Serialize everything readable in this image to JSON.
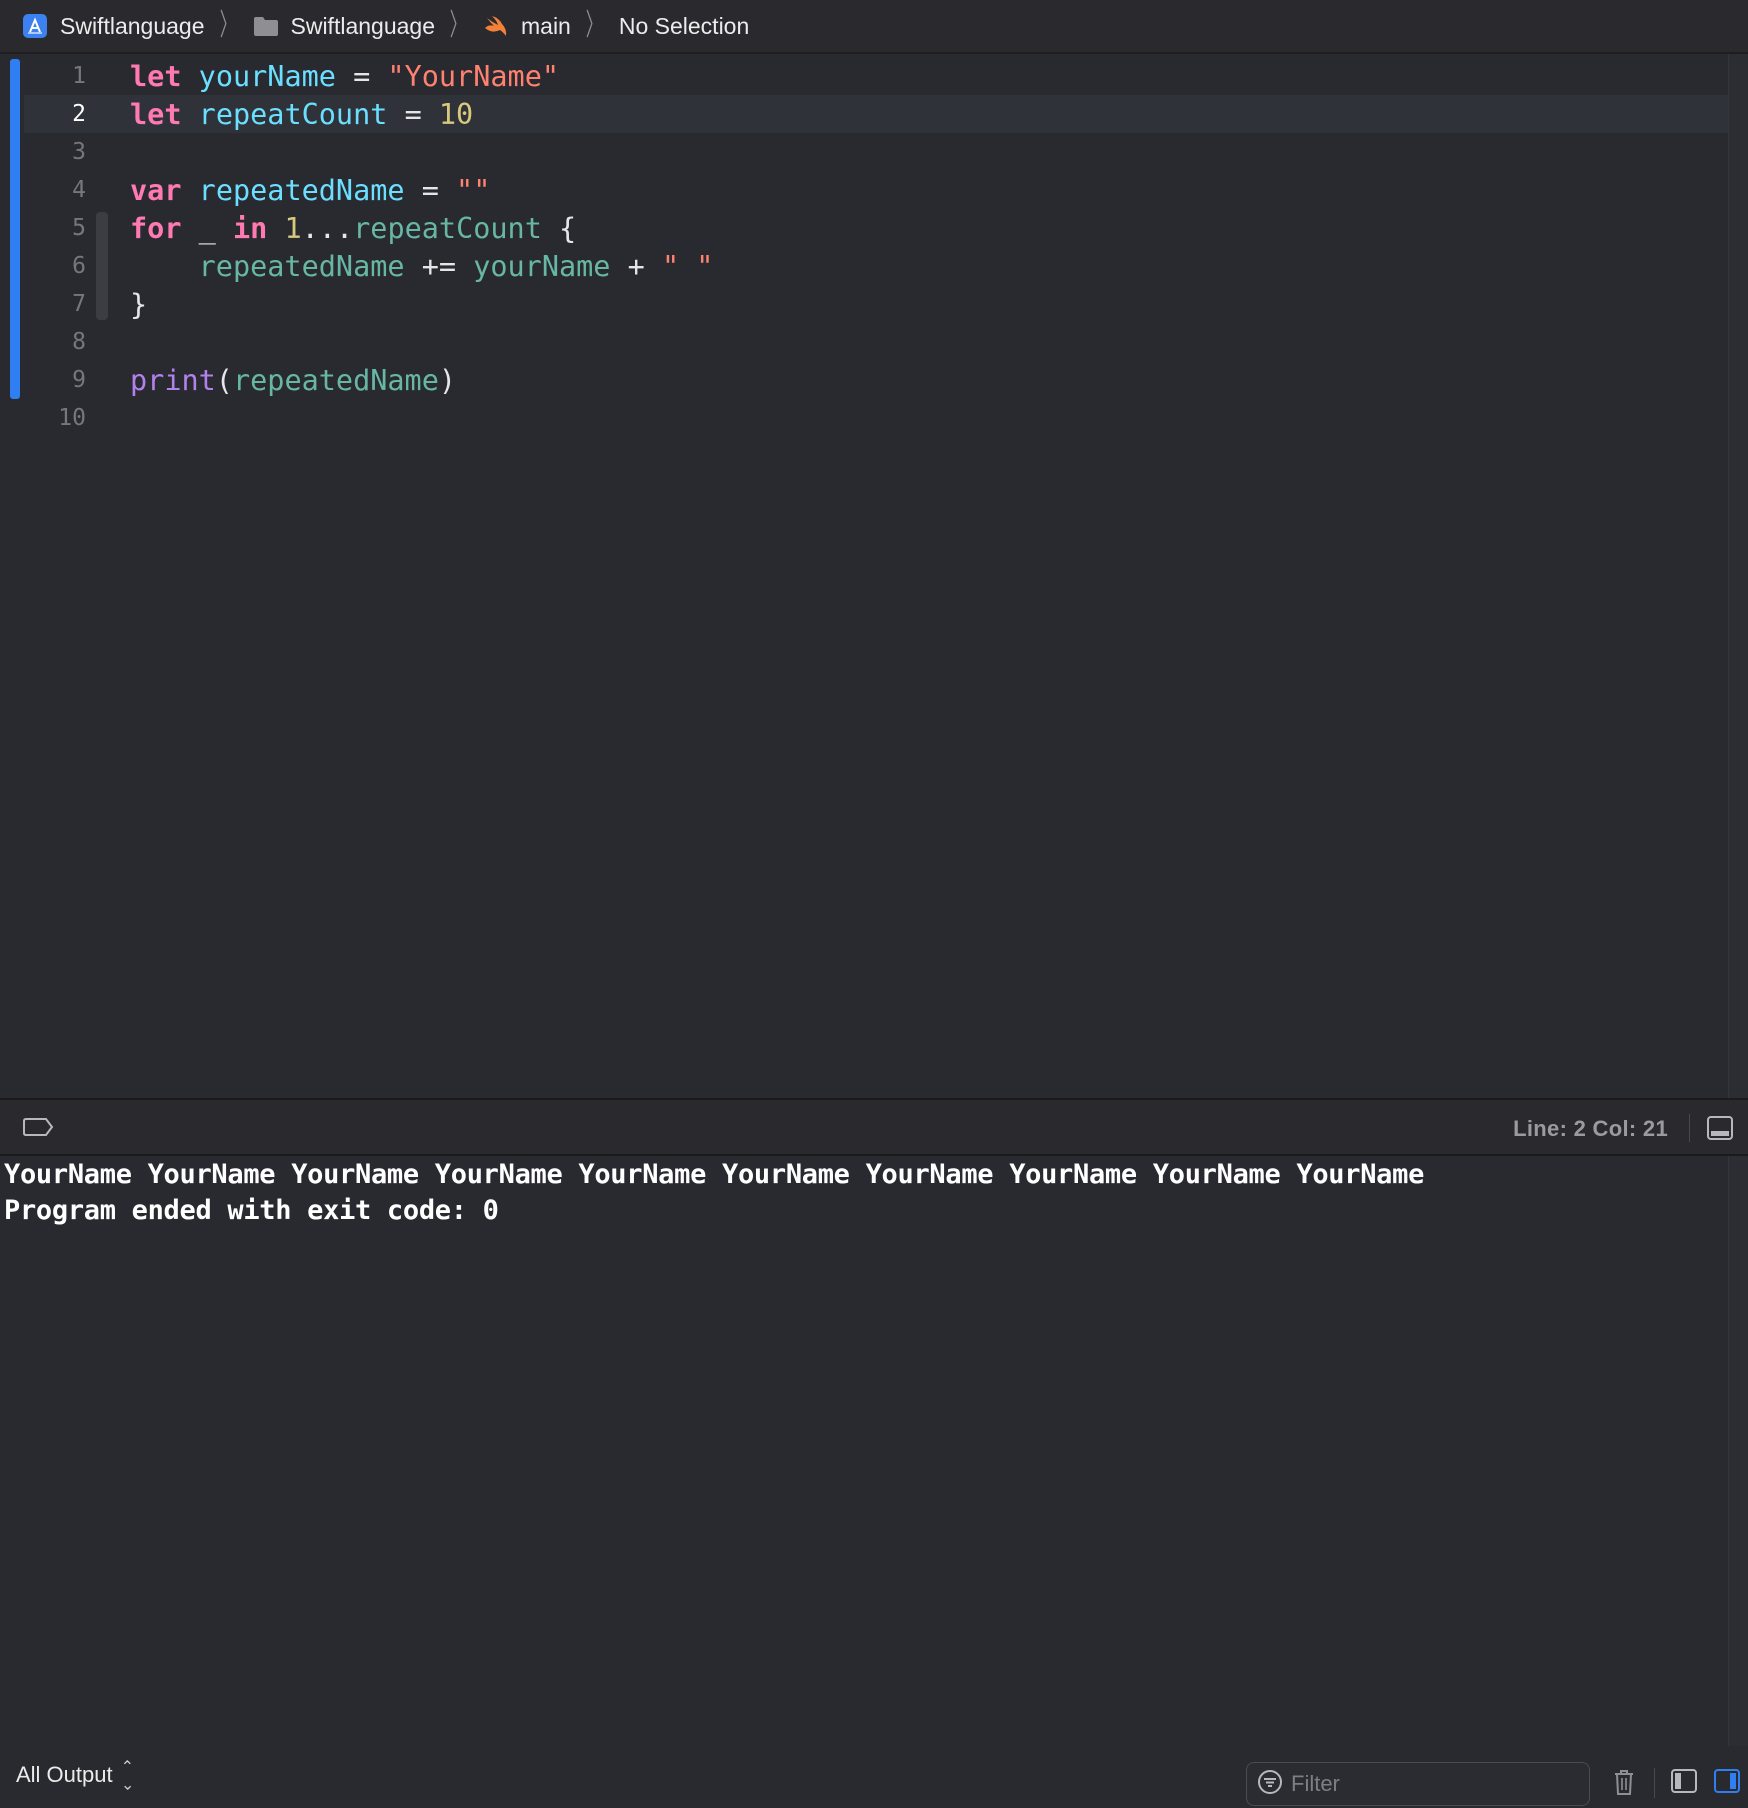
{
  "breadcrumb": {
    "project": "Swiftlanguage",
    "folder": "Swiftlanguage",
    "file": "main",
    "selection": "No Selection"
  },
  "editor": {
    "active_line": 2,
    "lines": [
      {
        "n": "1",
        "tokens": [
          [
            "kw",
            "let"
          ],
          [
            "plain",
            " "
          ],
          [
            "decl",
            "yourName"
          ],
          [
            "plain",
            " = "
          ],
          [
            "str",
            "\"YourName\""
          ]
        ]
      },
      {
        "n": "2",
        "tokens": [
          [
            "kw",
            "let"
          ],
          [
            "plain",
            " "
          ],
          [
            "decl",
            "repeatCount"
          ],
          [
            "plain",
            " = "
          ],
          [
            "num",
            "10"
          ]
        ]
      },
      {
        "n": "3",
        "tokens": []
      },
      {
        "n": "4",
        "tokens": [
          [
            "kw",
            "var"
          ],
          [
            "plain",
            " "
          ],
          [
            "decl",
            "repeatedName"
          ],
          [
            "plain",
            " = "
          ],
          [
            "str",
            "\"\""
          ]
        ]
      },
      {
        "n": "5",
        "tokens": [
          [
            "kw",
            "for"
          ],
          [
            "plain",
            " _ "
          ],
          [
            "kw",
            "in"
          ],
          [
            "plain",
            " "
          ],
          [
            "num",
            "1"
          ],
          [
            "plain",
            "..."
          ],
          [
            "ident",
            "repeatCount"
          ],
          [
            "plain",
            " {"
          ]
        ]
      },
      {
        "n": "6",
        "tokens": [
          [
            "plain",
            "    "
          ],
          [
            "ident",
            "repeatedName"
          ],
          [
            "plain",
            " += "
          ],
          [
            "ident",
            "yourName"
          ],
          [
            "plain",
            " + "
          ],
          [
            "str",
            "\" \""
          ]
        ]
      },
      {
        "n": "7",
        "tokens": [
          [
            "plain",
            "}"
          ]
        ]
      },
      {
        "n": "8",
        "tokens": []
      },
      {
        "n": "9",
        "tokens": [
          [
            "fn",
            "print"
          ],
          [
            "plain",
            "("
          ],
          [
            "ident",
            "repeatedName"
          ],
          [
            "plain",
            ")"
          ]
        ]
      },
      {
        "n": "10",
        "tokens": []
      }
    ]
  },
  "status": {
    "line_col": "Line: 2  Col: 21"
  },
  "console": {
    "output_line_1": "YourName YourName YourName YourName YourName YourName YourName YourName YourName YourName",
    "output_line_2": "Program ended with exit code: 0"
  },
  "bottom": {
    "output_selector": "All Output",
    "filter_placeholder": "Filter"
  },
  "icons": {
    "project": "xcode-project-icon",
    "folder": "folder-icon",
    "file": "swift-file-icon",
    "tag": "breakpoint-tag-icon",
    "panel": "hide-debug-area-icon",
    "filter": "filter-icon",
    "trash": "trash-icon",
    "split_left": "variables-view-icon",
    "split_right": "console-view-icon"
  },
  "colors": {
    "keyword": "#ff7ab2",
    "declaration": "#6bdfff",
    "identifier": "#67b7a4",
    "string": "#ff8170",
    "number": "#d9c97c",
    "function": "#b281eb",
    "accent": "#2f7ff2"
  }
}
